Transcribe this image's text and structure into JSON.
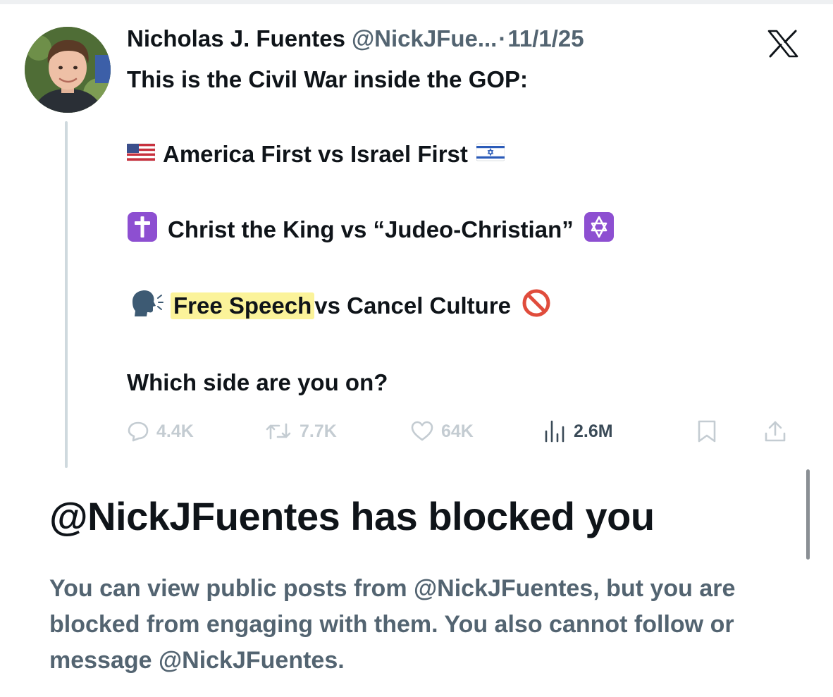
{
  "post": {
    "author_name": "Nicholas J. Fuentes",
    "author_handle": "@NickJFue...",
    "separator": "·",
    "date": "11/1/25",
    "platform_icon": "x-logo-icon",
    "intro": "This is the Civil War inside the GOP:",
    "lines": [
      {
        "icon_left": "us-flag-icon",
        "text": "America First vs Israel First",
        "icon_right": "israel-flag-icon"
      },
      {
        "icon_left": "latin-cross-icon",
        "text": "Christ the King vs “Judeo-Christian”",
        "icon_right": "star-of-david-icon"
      },
      {
        "icon_left": "speaking-head-icon",
        "highlight_text": "Free Speech",
        "text_rest": "vs Cancel Culture",
        "icon_right": "prohibited-icon"
      }
    ],
    "question": "Which side are you on?"
  },
  "actions": {
    "replies": {
      "icon": "reply-icon",
      "count": "4.4K"
    },
    "reposts": {
      "icon": "repost-icon",
      "count": "7.7K"
    },
    "likes": {
      "icon": "heart-icon",
      "count": "64K"
    },
    "views": {
      "icon": "views-icon",
      "count": "2.6M"
    },
    "bookmark": {
      "icon": "bookmark-icon"
    },
    "share": {
      "icon": "share-icon"
    }
  },
  "block_notice": {
    "title": "@NickJFuentes has blocked you",
    "description": "You can view public posts from @NickJFuentes, but you are blocked from engaging with them. You also cannot follow or message @NickJFuentes."
  },
  "colors": {
    "text_primary": "#0f1419",
    "text_secondary": "#536471",
    "action_faded": "#c4ccd2",
    "highlight": "#fbf39a",
    "thread_line": "#cfd9de"
  }
}
